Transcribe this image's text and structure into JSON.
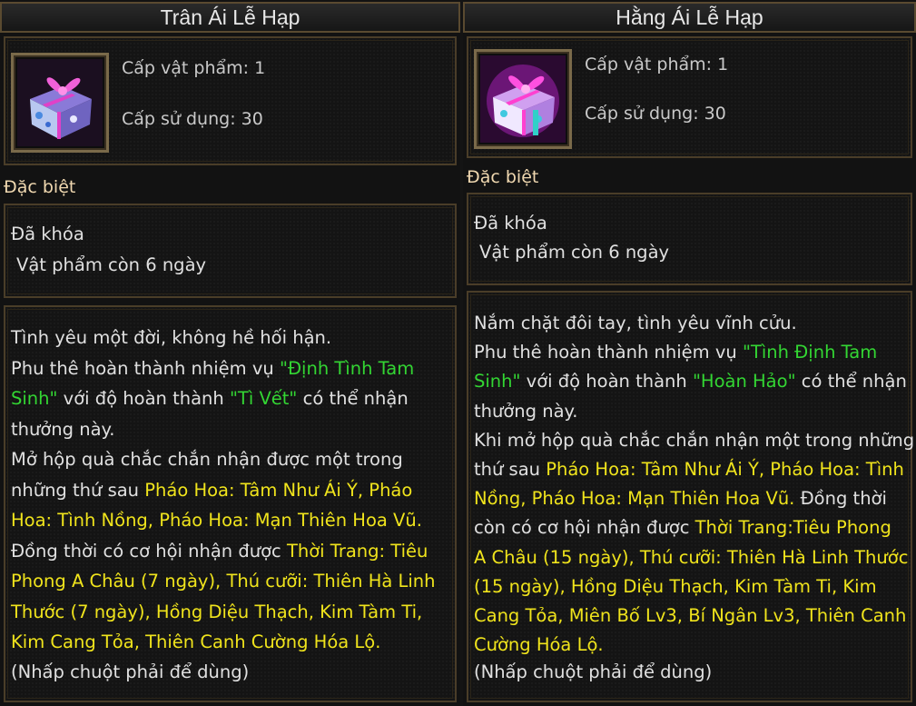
{
  "left": {
    "title": "Trân Ái Lễ Hạp",
    "item_level": "Cấp vật phẩm: 1",
    "use_level": "Cấp sử dụng: 30",
    "special_label": "Đặc biệt",
    "locked": "Đã khóa",
    "expiry": "Vật phẩm còn 6 ngày",
    "hint": "(Nhấp chuột phải để dùng)"
  },
  "right": {
    "title": "Hằng Ái Lễ Hạp",
    "item_level": "Cấp vật phẩm: 1",
    "use_level": "Cấp sử dụng: 30",
    "special_label": "Đặc biệt",
    "locked": "Đã khóa",
    "expiry": "Vật phẩm còn 6 ngày",
    "hint": "(Nhấp chuột phải để dùng)"
  },
  "desc_left": [
    [
      {
        "t": "Tình yêu một đời, không hề hối hận.",
        "c": "w"
      }
    ],
    [
      {
        "t": "Phu thê hoàn thành nhiệm vụ ",
        "c": "w"
      },
      {
        "t": "\"Định Tình Tam",
        "c": "g"
      }
    ],
    [
      {
        "t": " Sinh\"",
        "c": "g"
      },
      {
        "t": " với độ hoàn thành ",
        "c": "w"
      },
      {
        "t": "\"Tì Vết\"",
        "c": "g"
      },
      {
        "t": " có thể nhận",
        "c": "w"
      }
    ],
    [
      {
        "t": " thưởng này.",
        "c": "w"
      }
    ],
    [
      {
        "t": "Mở hộp quà chắc chắn nhận được một trong",
        "c": "w"
      }
    ],
    [
      {
        "t": " những thứ sau ",
        "c": "w"
      },
      {
        "t": "Pháo Hoa: Tâm Như Ái Ý, Pháo",
        "c": "y"
      }
    ],
    [
      {
        "t": " Hoa: Tình Nồng, Pháo Hoa: Mạn Thiên Hoa Vũ.",
        "c": "y"
      }
    ],
    [
      {
        "t": " Đồng thời có cơ hội nhận được ",
        "c": "w"
      },
      {
        "t": "Thời Trang: Tiêu",
        "c": "y"
      }
    ],
    [
      {
        "t": " Phong A Châu (7 ngày), Thú cưỡi: Thiên Hà Linh",
        "c": "y"
      }
    ],
    [
      {
        "t": " Thước (7 ngày), Hồng Diệu Thạch, Kim Tàm Ti,",
        "c": "y"
      }
    ],
    [
      {
        "t": " Kim Cang Tỏa, Thiên Canh Cường Hóa Lộ.",
        "c": "y"
      }
    ]
  ],
  "desc_right": [
    [
      {
        "t": "Nắm chặt đôi tay, tình yêu vĩnh cửu.",
        "c": "w"
      }
    ],
    [
      {
        "t": "Phu thê hoàn thành nhiệm vụ ",
        "c": "w"
      },
      {
        "t": "\"Tình Định Tam",
        "c": "g"
      }
    ],
    [
      {
        "t": " Sinh\"",
        "c": "g"
      },
      {
        "t": " với độ hoàn thành ",
        "c": "w"
      },
      {
        "t": "\"Hoàn Hảo\"",
        "c": "g"
      },
      {
        "t": " có thể nhận",
        "c": "w"
      }
    ],
    [
      {
        "t": " thưởng này.",
        "c": "w"
      }
    ],
    [
      {
        "t": "Khi mở hộp quà chắc chắn nhận một trong những",
        "c": "w"
      }
    ],
    [
      {
        "t": " thứ sau ",
        "c": "w"
      },
      {
        "t": "Pháo Hoa: Tâm Như Ái Ý, Pháo Hoa: Tình",
        "c": "y"
      }
    ],
    [
      {
        "t": " Nồng, Pháo Hoa: Mạn Thiên Hoa Vũ.",
        "c": "y"
      },
      {
        "t": " Đồng thời",
        "c": "w"
      }
    ],
    [
      {
        "t": " còn có cơ hội nhận được ",
        "c": "w"
      },
      {
        "t": "Thời Trang:Tiêu Phong",
        "c": "y"
      }
    ],
    [
      {
        "t": " A Châu (15 ngày), Thú cưỡi: Thiên Hà Linh Thước",
        "c": "y"
      }
    ],
    [
      {
        "t": " (15 ngày), Hồng Diệu Thạch, Kim Tàm Ti, Kim",
        "c": "y"
      }
    ],
    [
      {
        "t": " Cang Tỏa, Miên Bố Lv3, Bí Ngân Lv3, Thiên Canh",
        "c": "y"
      }
    ],
    [
      {
        "t": " Cường Hóa Lộ.",
        "c": "y"
      }
    ]
  ],
  "colors": {
    "white": "#e0e0e0",
    "green": "#33d633",
    "yellow": "#f0e41c",
    "cyan": "#a8dce8",
    "label": "#f0d8b0"
  },
  "icons": {
    "left": "gift-box-icon",
    "right": "gift-box-icon"
  }
}
